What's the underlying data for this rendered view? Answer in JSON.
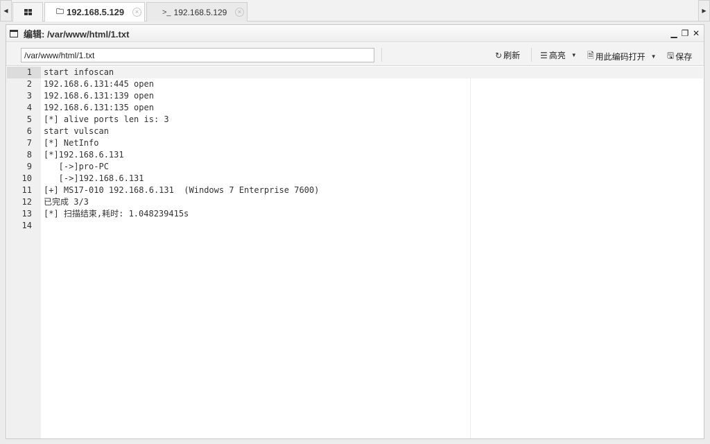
{
  "tabs": [
    {
      "label": "192.168.5.129",
      "icon": "folder-icon",
      "close": "×"
    },
    {
      "label": "192.168.5.129",
      "icon": "terminal-icon",
      "glyph": ">_",
      "close": "×"
    }
  ],
  "window": {
    "title": "编辑: /var/www/html/1.txt",
    "controls": {
      "minimize": "▁",
      "restore": "❐",
      "close": "✕"
    }
  },
  "toolbar": {
    "path_value": "/var/www/html/1.txt",
    "refresh_label": "刷新",
    "highlight_label": "高亮",
    "open_with_encoding_label": "用此编码打开",
    "save_label": "保存"
  },
  "editor": {
    "current_line": 1,
    "lines": [
      {
        "n": "1",
        "text": "start infoscan"
      },
      {
        "n": "2",
        "text": "192.168.6.131:445 open"
      },
      {
        "n": "3",
        "text": "192.168.6.131:139 open"
      },
      {
        "n": "4",
        "text": "192.168.6.131:135 open"
      },
      {
        "n": "5",
        "text": "[*] alive ports len is: 3"
      },
      {
        "n": "6",
        "text": "start vulscan"
      },
      {
        "n": "7",
        "text": "[*] NetInfo"
      },
      {
        "n": "8",
        "text": "[*]192.168.6.131"
      },
      {
        "n": "9",
        "text": "   [->]pro-PC"
      },
      {
        "n": "10",
        "text": "   [->]192.168.6.131"
      },
      {
        "n": "11",
        "text": "[+] MS17-010 192.168.6.131  (Windows 7 Enterprise 7600)"
      },
      {
        "n": "12",
        "text": "已完成 3/3"
      },
      {
        "n": "13",
        "text": "[*] 扫描结束,耗时: 1.048239415s"
      },
      {
        "n": "14",
        "text": ""
      }
    ]
  }
}
